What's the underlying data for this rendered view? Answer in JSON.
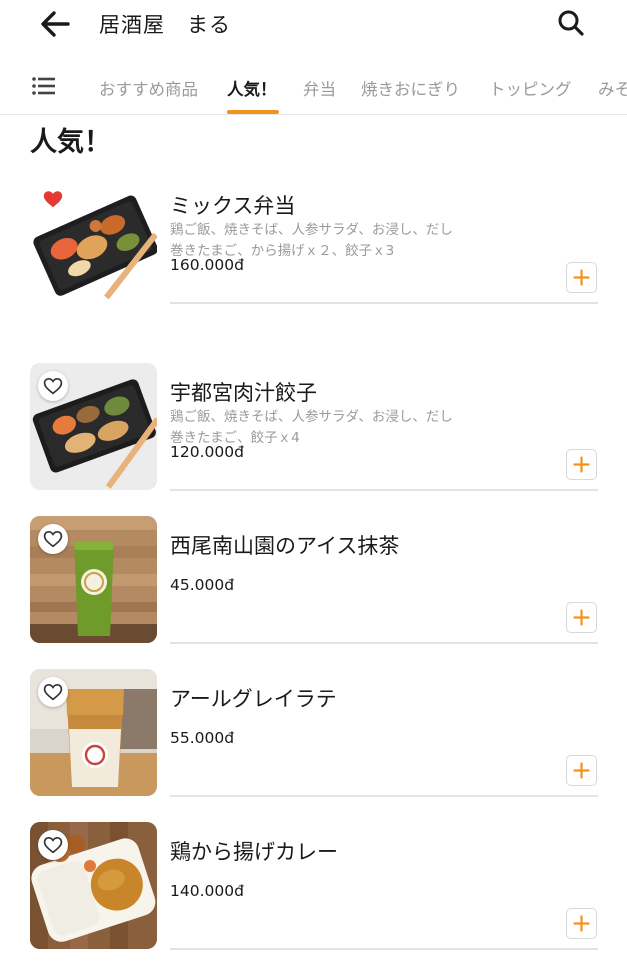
{
  "header": {
    "store_name": "居酒屋　まる",
    "back_icon": "arrow-left-icon",
    "search_icon": "search-icon"
  },
  "tabs": {
    "menu_icon": "hamburger-menu-icon",
    "items": [
      {
        "label": "おすすめ商品",
        "active": false
      },
      {
        "label": "人気！",
        "active": true
      },
      {
        "label": "弁当",
        "active": false
      },
      {
        "label": "焼きおにぎり",
        "active": false
      },
      {
        "label": "トッピング",
        "active": false
      },
      {
        "label": "みそ",
        "active": false
      }
    ],
    "accent_color": "#f2921d"
  },
  "section": {
    "title": "人気！"
  },
  "items": [
    {
      "name": "ミックス弁当",
      "description": "鶏ご飯、焼きそば、人参サラダ、お浸し、だし巻きたまご、から揚げｘ２、餃子ｘ3",
      "price": "160.000đ",
      "favorite": true
    },
    {
      "name": "宇都宮肉汁餃子",
      "description": "鶏ご飯、焼きそば、人参サラダ、お浸し、だし巻きたまご、餃子ｘ4",
      "price": "120.000đ",
      "favorite": false
    },
    {
      "name": "西尾南山園のアイス抹茶",
      "description": "",
      "price": "45.000đ",
      "favorite": false
    },
    {
      "name": "アールグレイラテ",
      "description": "",
      "price": "55.000đ",
      "favorite": false
    },
    {
      "name": "鶏から揚げカレー",
      "description": "",
      "price": "140.000đ",
      "favorite": false
    }
  ],
  "colors": {
    "favorite_heart": "#e53935",
    "add_plus": "#f2921d"
  }
}
